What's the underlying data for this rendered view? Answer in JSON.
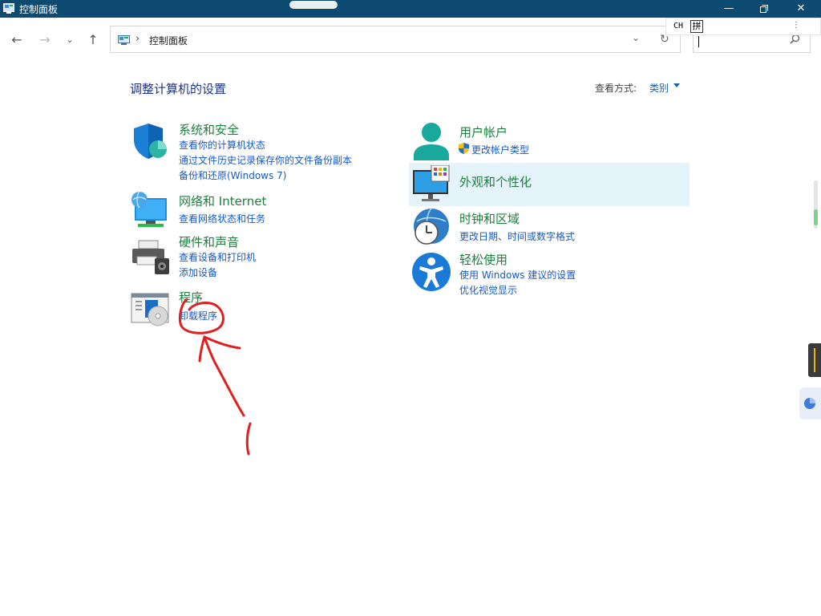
{
  "window": {
    "title": "控制面板"
  },
  "address": {
    "crumb": "控制面板",
    "search_value": ""
  },
  "ime": {
    "lang": "CH",
    "mode": "拼"
  },
  "content": {
    "heading": "调整计算机的设置",
    "view_by_label": "查看方式:",
    "view_by_value": "类别"
  },
  "categories": {
    "system": {
      "title": "系统和安全",
      "links": [
        "查看你的计算机状态",
        "通过文件历史记录保存你的文件备份副本",
        "备份和还原(Windows 7)"
      ]
    },
    "network": {
      "title": "网络和 Internet",
      "links": [
        "查看网络状态和任务"
      ]
    },
    "hardware": {
      "title": "硬件和声音",
      "links": [
        "查看设备和打印机",
        "添加设备"
      ]
    },
    "programs": {
      "title": "程序",
      "links": [
        "卸载程序"
      ]
    },
    "users": {
      "title": "用户帐户",
      "links": [
        "更改帐户类型"
      ]
    },
    "appearance": {
      "title": "外观和个性化",
      "links": []
    },
    "clock": {
      "title": "时钟和区域",
      "links": [
        "更改日期、时间或数字格式"
      ]
    },
    "ease": {
      "title": "轻松使用",
      "links": [
        "使用 Windows 建议的设置",
        "优化视觉显示"
      ]
    }
  },
  "colors": {
    "titlebar": "#0d4a72",
    "category_title": "#1d7f3c",
    "link": "#1659c4",
    "heading": "#1e3287",
    "hover": "#e5f3fb",
    "annotation": "#e02020"
  }
}
